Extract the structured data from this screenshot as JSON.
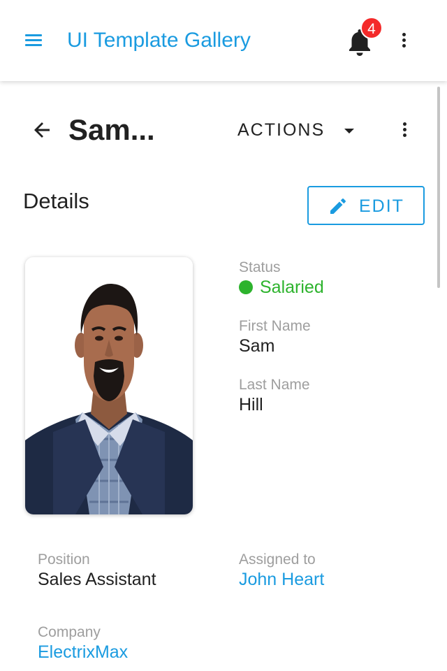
{
  "colors": {
    "accent": "#1a9be0",
    "badge": "#f42a2a",
    "success": "#2db32d"
  },
  "appbar": {
    "menu_icon": "hamburger-menu-icon",
    "title": "UI Template Gallery",
    "notifications_icon": "bell-icon",
    "notification_count": "4",
    "more_icon": "more-vertical-icon"
  },
  "page": {
    "back_icon": "arrow-back-icon",
    "title": "Sam...",
    "actions_label": "ACTIONS",
    "actions_icon": "caret-down-icon",
    "more_icon": "more-vertical-icon"
  },
  "details": {
    "section_title": "Details",
    "edit_icon": "pencil-icon",
    "edit_label": "EDIT",
    "photo_icon": "employee-photo",
    "status": {
      "label": "Status",
      "value": "Salaried"
    },
    "first_name": {
      "label": "First Name",
      "value": "Sam"
    },
    "last_name": {
      "label": "Last Name",
      "value": "Hill"
    },
    "position": {
      "label": "Position",
      "value": "Sales Assistant"
    },
    "assigned_to": {
      "label": "Assigned to",
      "value": "John Heart"
    },
    "company": {
      "label": "Company",
      "value": "ElectrixMax"
    }
  }
}
